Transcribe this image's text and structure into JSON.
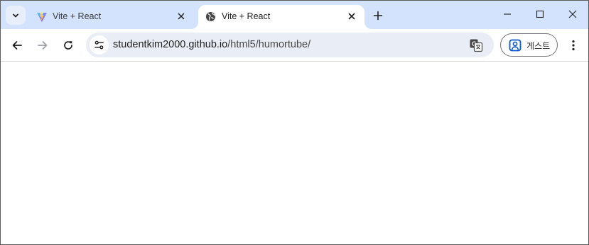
{
  "tabs": [
    {
      "title": "Vite + React",
      "favicon": "vite-logo-icon",
      "active": false
    },
    {
      "title": "Vite + React",
      "favicon": "globe-icon",
      "active": true
    }
  ],
  "address_bar": {
    "host": "studentkim2000.github.io",
    "path": "/html5/humortube/"
  },
  "profile": {
    "label": "게스트"
  },
  "colors": {
    "tabstrip_bg": "#d3e3fd",
    "omnibox_bg": "#e9eef6",
    "accent_blue": "#0b57d0"
  }
}
